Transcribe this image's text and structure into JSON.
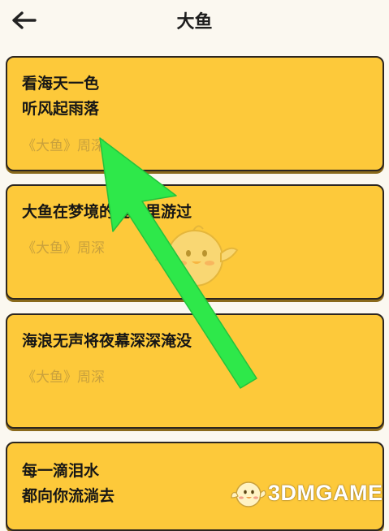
{
  "header": {
    "title": "大鱼",
    "back_icon": "arrow-left-icon"
  },
  "cards": [
    {
      "lines": [
        "看海天一色",
        "听风起雨落"
      ],
      "source": "《大鱼》周深"
    },
    {
      "lines": [
        "大鱼在梦境的缝隙里游过"
      ],
      "source": "《大鱼》周深"
    },
    {
      "lines": [
        "海浪无声将夜幕深深淹没"
      ],
      "source": "《大鱼》周深"
    },
    {
      "lines": [
        "每一滴泪水",
        "都向你流淌去"
      ],
      "source": ""
    }
  ],
  "watermark": {
    "text": "3DMGAME"
  },
  "colors": {
    "background": "#fbf8f0",
    "card": "#fdc93a",
    "card_border": "#2c2620",
    "source_text": "#c9a13c",
    "annotation_arrow": "#2ee84a"
  }
}
